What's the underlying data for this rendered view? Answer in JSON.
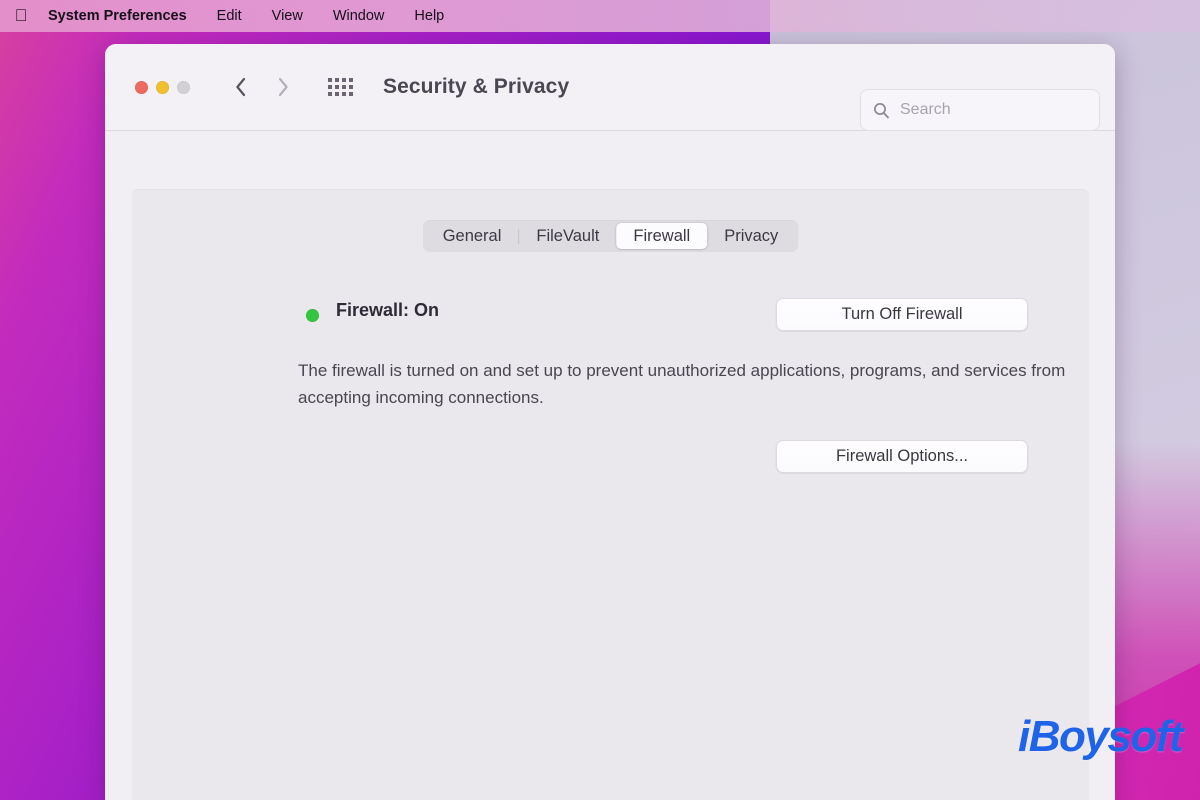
{
  "menubar": {
    "apple_icon": "apple-logo-icon",
    "items": [
      {
        "label": "System Preferences",
        "bold": true
      },
      {
        "label": "Edit"
      },
      {
        "label": "View"
      },
      {
        "label": "Window"
      },
      {
        "label": "Help"
      }
    ]
  },
  "window": {
    "title": "Security & Privacy",
    "traffic_lights": {
      "close": "#ec6a5f",
      "minimize": "#eebf2f",
      "zoom_disabled": "#d2d0d4"
    },
    "toolbar": {
      "back_icon": "chevron-left-icon",
      "forward_icon": "chevron-right-icon",
      "grid_icon": "grid-show-all-icon",
      "search": {
        "icon": "search-icon",
        "value": "",
        "placeholder": "Search"
      }
    }
  },
  "tabs": [
    {
      "label": "General",
      "selected": false
    },
    {
      "label": "FileVault",
      "selected": false
    },
    {
      "label": "Firewall",
      "selected": true
    },
    {
      "label": "Privacy",
      "selected": false
    }
  ],
  "firewall": {
    "status_dot_color": "#34c63f",
    "status_label": "Firewall: On",
    "status_value": "On",
    "toggle_button": "Turn Off Firewall",
    "description": "The firewall is turned on and set up to prevent unauthorized applications, programs, and services from accepting incoming connections.",
    "options_button": "Firewall Options..."
  },
  "watermark": {
    "text": "iBoysoft",
    "color": "#1f63e8"
  }
}
